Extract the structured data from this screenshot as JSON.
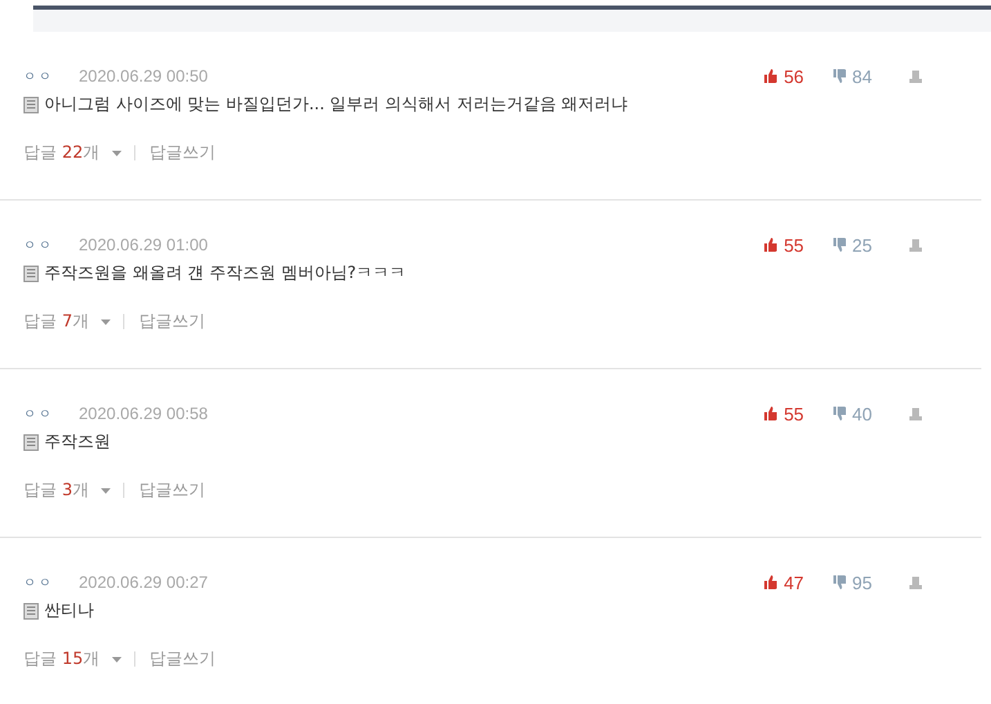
{
  "comments": [
    {
      "author": "ㅇㅇ",
      "date": "2020.06.29 00:50",
      "text": "아니그럼 사이즈에 맞는 바질입던가... 일부러 의식해서 저러는거같음 왜저러냐",
      "likes": "56",
      "dislikes": "84",
      "reply_label": "답글",
      "reply_count": "22",
      "reply_unit": "개",
      "write_reply": "답글쓰기"
    },
    {
      "author": "ㅇㅇ",
      "date": "2020.06.29 01:00",
      "text": "주작즈원을 왜올려 걘 주작즈원 멤버아님?ㅋㅋㅋ",
      "likes": "55",
      "dislikes": "25",
      "reply_label": "답글",
      "reply_count": "7",
      "reply_unit": "개",
      "write_reply": "답글쓰기"
    },
    {
      "author": "ㅇㅇ",
      "date": "2020.06.29 00:58",
      "text": "주작즈원",
      "likes": "55",
      "dislikes": "40",
      "reply_label": "답글",
      "reply_count": "3",
      "reply_unit": "개",
      "write_reply": "답글쓰기"
    },
    {
      "author": "ㅇㅇ",
      "date": "2020.06.29 00:27",
      "text": "싼티나",
      "likes": "47",
      "dislikes": "95",
      "reply_label": "답글",
      "reply_count": "15",
      "reply_unit": "개",
      "write_reply": "답글쓰기"
    }
  ]
}
